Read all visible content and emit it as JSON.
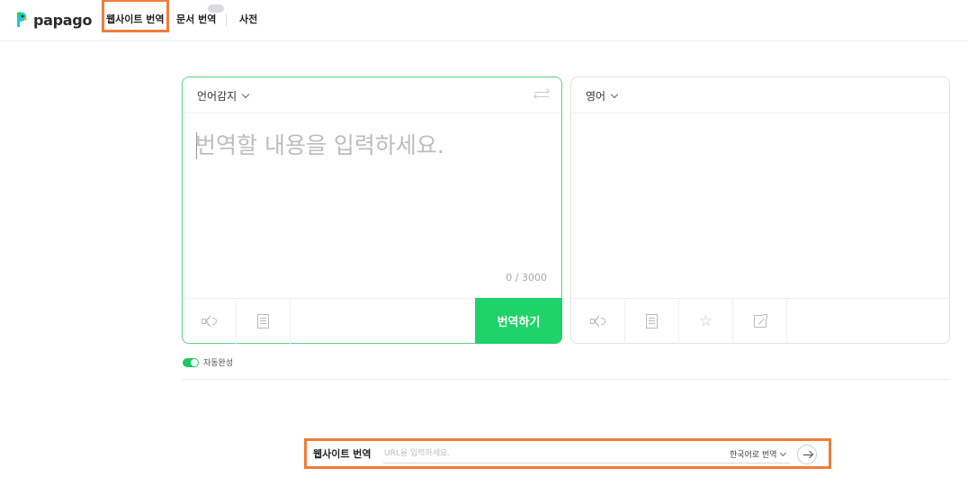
{
  "header": {
    "logo_text": "papago",
    "nav": {
      "website_translate": "웹사이트 번역",
      "document_translate": "문서 번역",
      "dictionary": "사전"
    },
    "beta_badge_icon": "beta-badge"
  },
  "source_panel": {
    "language": "언어감지",
    "placeholder": "번역할 내용을 입력하세요.",
    "char_count": "0 / 3000",
    "translate_button": "번역하기",
    "tools": [
      "speaker-icon",
      "document-icon"
    ]
  },
  "target_panel": {
    "language": "영어",
    "tools": [
      "speaker-icon",
      "document-icon",
      "star-icon",
      "share-icon"
    ]
  },
  "autocomplete": {
    "label": "자동완성",
    "enabled": true
  },
  "website_bar": {
    "title": "웹사이트 번역",
    "url_placeholder": "URL을 입력하세요.",
    "target_language": "한국어로 번역"
  },
  "colors": {
    "accent_green": "#1ed36a",
    "highlight_orange": "#f07d3a",
    "source_border": "#5fd08a"
  }
}
